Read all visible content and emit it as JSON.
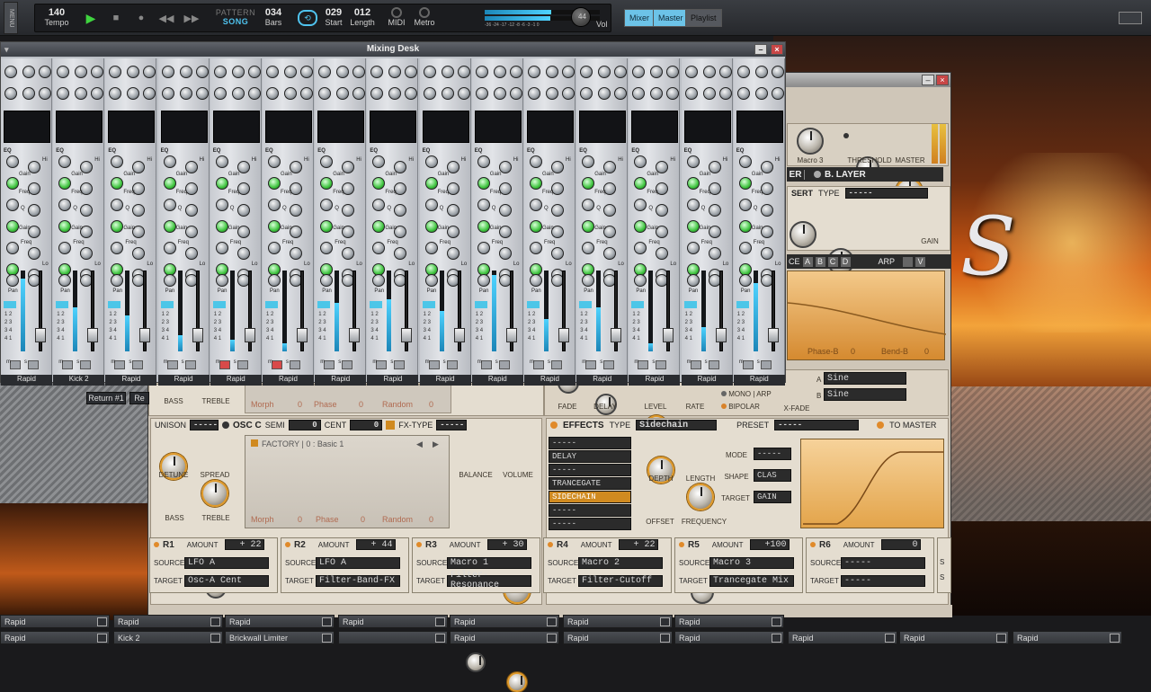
{
  "topbar": {
    "tempo_value": "140",
    "tempo_label": "Tempo",
    "pattern_label": "PATTERN",
    "song_label": "SONG",
    "bars_value": "034",
    "bars_label": "Bars",
    "start_value": "029",
    "start_label": "Start",
    "length_value": "012",
    "length_label": "Length",
    "midi_label": "MIDI",
    "metro_label": "Metro",
    "meter_scale": "-36 -24 -17 -12 -8 -6 -3 -1 0",
    "vol_value": "44",
    "vol_label": "Vol",
    "menu_label": "MENU",
    "views": [
      "Mixer",
      "Master",
      "Playlist"
    ]
  },
  "mixer": {
    "title": "Mixing Desk",
    "eq_label": "EQ",
    "labels": {
      "hi": "Hi",
      "gain": "Gain",
      "freq": "Freq",
      "q": "Q",
      "mid": "Mid",
      "lo": "Lo",
      "pan": "Pan",
      "lomid": "Lo Mid",
      "himid": "Hi Mid",
      "m": "m",
      "s": "s",
      "sends": [
        "1",
        "2",
        "3",
        "4"
      ]
    },
    "channels": [
      {
        "name": "Rapid",
        "mute": false,
        "vu": 0.9
      },
      {
        "name": "Kick 2",
        "mute": false,
        "vu": 0.55
      },
      {
        "name": "Rapid",
        "mute": false,
        "vu": 0.45
      },
      {
        "name": "Rapid",
        "mute": false,
        "vu": 0.2
      },
      {
        "name": "Rapid",
        "mute": true,
        "vu": 0.15
      },
      {
        "name": "Rapid",
        "mute": true,
        "vu": 0.1
      },
      {
        "name": "Rapid",
        "mute": false,
        "vu": 0.6
      },
      {
        "name": "Rapid",
        "mute": false,
        "vu": 0.65
      },
      {
        "name": "Rapid",
        "mute": false,
        "vu": 0.5
      },
      {
        "name": "Rapid",
        "mute": false,
        "vu": 0.95
      },
      {
        "name": "Rapid",
        "mute": false,
        "vu": 0.4
      },
      {
        "name": "Rapid",
        "mute": false,
        "vu": 0.55
      },
      {
        "name": "Rapid",
        "mute": false,
        "vu": 0.1
      },
      {
        "name": "Rapid",
        "mute": false,
        "vu": 0.3
      },
      {
        "name": "Rapid",
        "mute": false,
        "vu": 0.85
      }
    ],
    "return_label": "Return #1",
    "return2_label": "Re"
  },
  "synth": {
    "macro3_label": "Macro 3",
    "threshold_label": "THRESHOLD",
    "master_label": "MASTER",
    "layer_label": "B. LAYER",
    "insert_label": "SERT",
    "type_label": "TYPE",
    "insert_type": "-----",
    "gain_label": "GAIN",
    "ce_label": "CE",
    "abcd": [
      "A",
      "B",
      "C",
      "D"
    ],
    "arp_label": "ARP",
    "v_label": "V",
    "phase_b_label": "Phase-B",
    "phase_b_value": "0",
    "bend_b_label": "Bend-B",
    "bend_b_value": "0",
    "bass_label": "BASS",
    "treble_label": "TREBLE",
    "morph_label": "Morph",
    "morph_value": "0",
    "phase_label": "Phase",
    "phase_value": "0",
    "random_label": "Random",
    "random_value": "0",
    "fade_label": "FADE",
    "delay_label": "DELAY",
    "level_label": "LEVEL",
    "rate_label": "RATE",
    "mono_arp": "MONO | ARP",
    "bipolar": "BIPOLAR",
    "xfade_label": "X-FADE",
    "lfo_a_label": "A",
    "lfo_b_label": "B",
    "lfo_a_shape": "Sine",
    "lfo_b_shape": "Sine",
    "er_label": "ER",
    "osc": {
      "unison_label": "UNISON",
      "unison_value": "-----",
      "title": "OSC C",
      "semi_label": "SEMI",
      "semi_value": "0",
      "cent_label": "CENT",
      "cent_value": "0",
      "fx_type_label": "FX-TYPE",
      "fx_type_value": "-----",
      "detune_label": "DETUNE",
      "spread_label": "SPREAD",
      "bass_label": "BASS",
      "treble_label": "TREBLE",
      "wave_preset": "FACTORY | 0 : Basic 1",
      "balance_label": "BALANCE",
      "volume_label": "VOLUME",
      "morph_label": "Morph",
      "morph_value": "0",
      "phase_label": "Phase",
      "phase_value": "0",
      "random_label": "Random",
      "random_value": "0"
    },
    "effects": {
      "title": "EFFECTS",
      "type_label": "TYPE",
      "type_value": "Sidechain",
      "preset_label": "PRESET",
      "preset_value": "-----",
      "to_master": "TO MASTER",
      "slots": [
        "-----",
        "DELAY",
        "-----",
        "TRANCEGATE",
        "SIDECHAIN",
        "-----",
        "-----"
      ],
      "depth_label": "DEPTH",
      "length_label": "LENGTH",
      "mode_label": "MODE",
      "mode_value": "-----",
      "shape_label": "SHAPE",
      "shape_value": "CLAS",
      "target_label": "TARGET",
      "target_value": "GAIN",
      "offset_label": "OFFSET",
      "frequency_label": "FREQUENCY"
    },
    "mod_routing": [
      {
        "id": "R1",
        "amount_label": "AMOUNT",
        "amount": "+ 22",
        "source_label": "SOURCE",
        "source": "LFO A",
        "target_label": "TARGET",
        "target": "Osc-A Cent"
      },
      {
        "id": "R2",
        "amount_label": "AMOUNT",
        "amount": "+ 44",
        "source_label": "SOURCE",
        "source": "LFO A",
        "target_label": "TARGET",
        "target": "Filter-Band-FX"
      },
      {
        "id": "R3",
        "amount_label": "AMOUNT",
        "amount": "+ 30",
        "source_label": "SOURCE",
        "source": "Macro 1",
        "target_label": "TARGET",
        "target": "Filter-Resonance"
      },
      {
        "id": "R4",
        "amount_label": "AMOUNT",
        "amount": "+ 22",
        "source_label": "SOURCE",
        "source": "Macro 2",
        "target_label": "TARGET",
        "target": "Filter-Cutoff"
      },
      {
        "id": "R5",
        "amount_label": "AMOUNT",
        "amount": "+100",
        "source_label": "SOURCE",
        "source": "Macro 3",
        "target_label": "TARGET",
        "target": "Trancegate Mix"
      },
      {
        "id": "R6",
        "amount_label": "AMOUNT",
        "amount": "0",
        "source_label": "SOURCE",
        "source": "-----",
        "target_label": "TARGET",
        "target": "-----"
      }
    ],
    "mod_partial_label": "S",
    "mod_partial_label2": "S"
  },
  "tracks_row1": [
    "Rapid",
    "Rapid",
    "Rapid",
    "Rapid",
    "Rapid",
    "Rapid",
    "Rapid"
  ],
  "tracks_row2": [
    "Rapid",
    "Kick 2",
    "Brickwall Limiter",
    "",
    "Rapid",
    "Rapid",
    "Rapid",
    "Rapid",
    "Rapid",
    "Rapid"
  ],
  "colors": {
    "accent": "#6cc3e8",
    "play": "#3fd43f",
    "mute_on": "#d84a4a",
    "knob_gold": "#e09a2a"
  }
}
